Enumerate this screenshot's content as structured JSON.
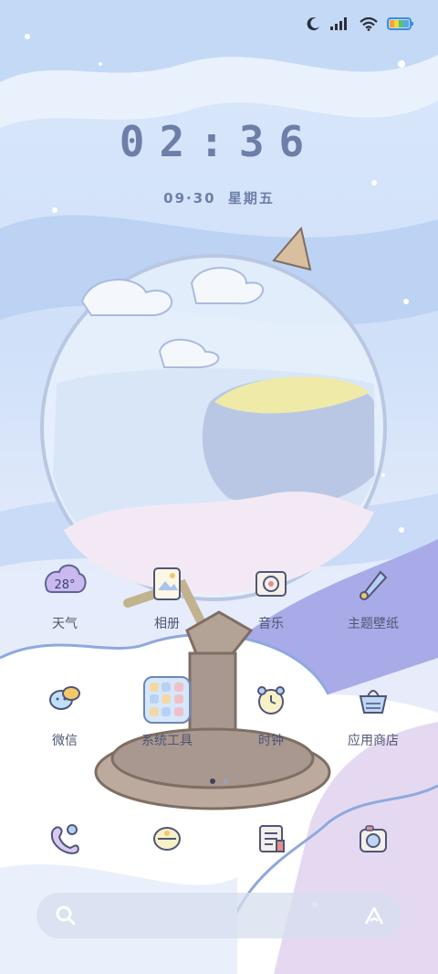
{
  "status": {
    "icons": [
      "moon-icon",
      "signal-icon",
      "wifi-icon",
      "battery-icon"
    ]
  },
  "clock": {
    "time": "02:36"
  },
  "date": {
    "day": "09·30",
    "weekday": "星期五"
  },
  "apps_row1": [
    {
      "label": "天气",
      "icon": "weather-icon",
      "temp": "28°"
    },
    {
      "label": "相册",
      "icon": "gallery-icon"
    },
    {
      "label": "音乐",
      "icon": "music-icon"
    },
    {
      "label": "主题壁纸",
      "icon": "themes-icon"
    }
  ],
  "apps_row2": [
    {
      "label": "微信",
      "icon": "wechat-icon"
    },
    {
      "label": "系统工具",
      "icon": "folder-icon"
    },
    {
      "label": "时钟",
      "icon": "clock-icon"
    },
    {
      "label": "应用商店",
      "icon": "app-store-icon"
    }
  ],
  "pager": {
    "pages": 2,
    "current": 1
  },
  "dock": [
    "phone-icon",
    "messages-icon",
    "notes-icon",
    "camera-icon"
  ],
  "colors": {
    "accent": "#6d7fa8",
    "text": "#4e5671",
    "outline": "#6f87b7"
  }
}
